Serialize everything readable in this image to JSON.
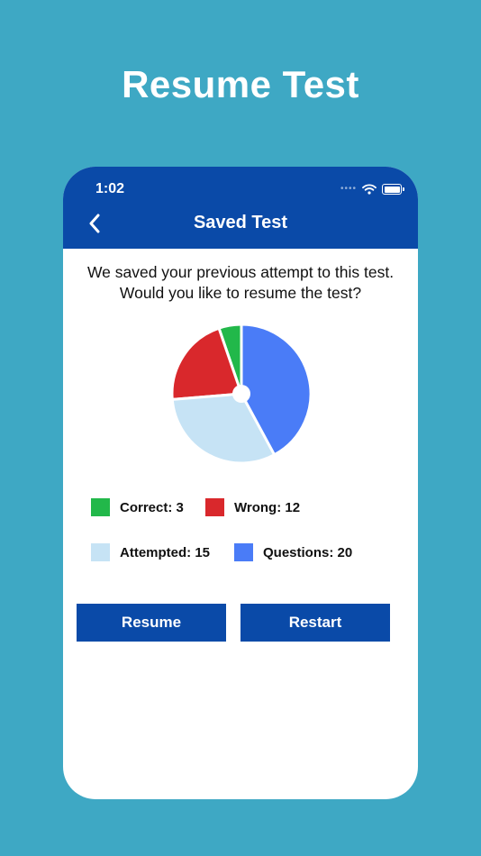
{
  "headline": "Resume Test",
  "status_bar": {
    "time": "1:02"
  },
  "nav": {
    "title": "Saved Test"
  },
  "message": {
    "line1": "We saved your previous attempt to this test.",
    "line2": "Would you like to resume the test?"
  },
  "chart_data": {
    "type": "pie",
    "slices": [
      {
        "name": "Correct",
        "value": 1,
        "color": "#22b84a"
      },
      {
        "name": "Wrong",
        "value": 4,
        "color": "#d9282c"
      },
      {
        "name": "Attempted",
        "value": 6,
        "color": "#c6e3f5"
      },
      {
        "name": "Questions",
        "value": 8,
        "color": "#4a7cf7"
      }
    ]
  },
  "legend": {
    "correct": {
      "label": "Correct: 3",
      "color": "#22b84a"
    },
    "wrong": {
      "label": "Wrong: 12",
      "color": "#d9282c"
    },
    "attempted": {
      "label": "Attempted: 15",
      "color": "#c6e3f5"
    },
    "questions": {
      "label": "Questions: 20",
      "color": "#4a7cf7"
    }
  },
  "buttons": {
    "resume": "Resume",
    "restart": "Restart"
  },
  "colors": {
    "background": "#3ea8c4",
    "brand": "#0a4aa8"
  }
}
